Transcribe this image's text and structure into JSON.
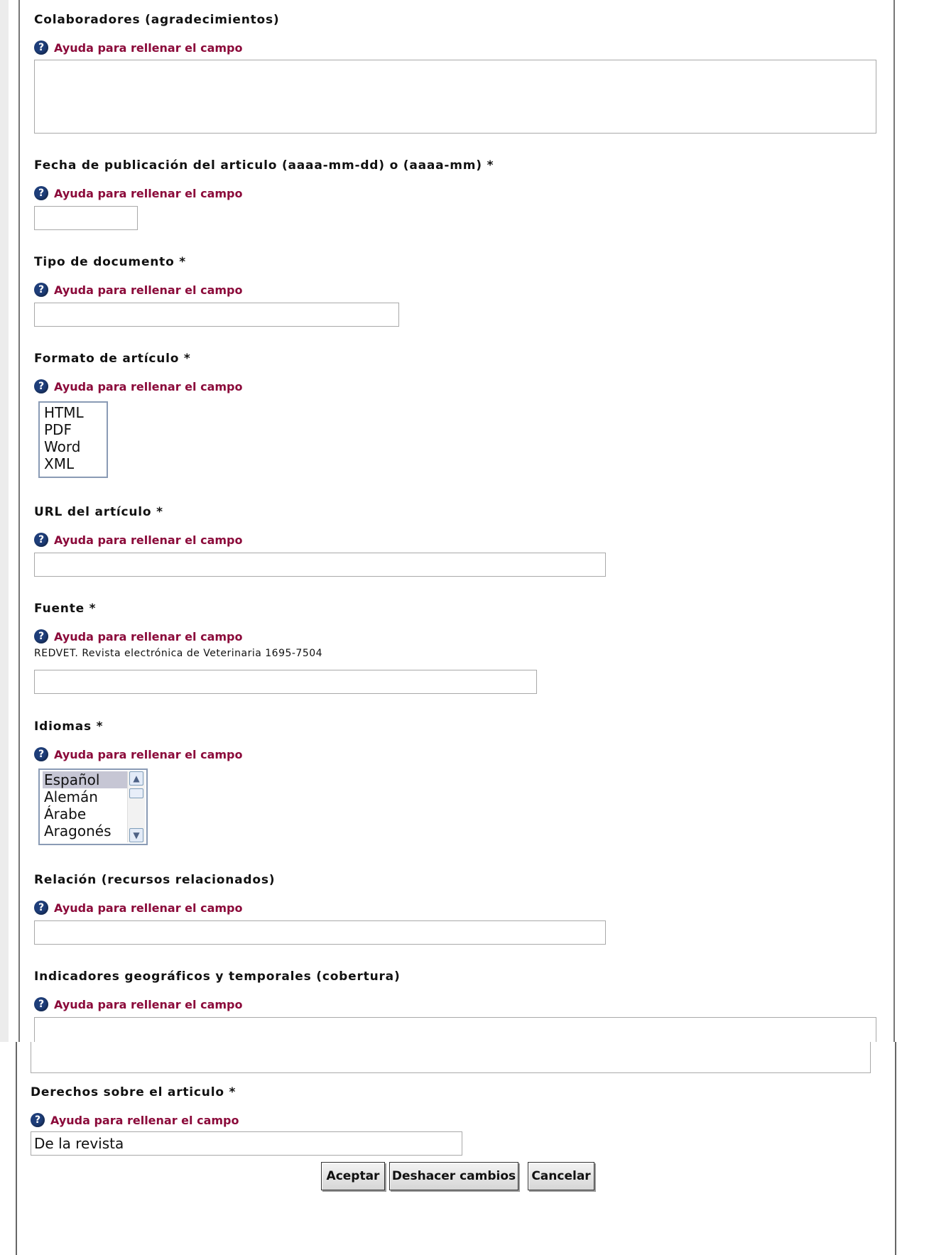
{
  "help_text": "Ayuda para rellenar el campo",
  "colors": {
    "help_link": "#8b0a3a",
    "help_icon": "#1e3e7a"
  },
  "icons": {
    "help": "question-circle-icon"
  },
  "fields": {
    "colaboradores": {
      "label": "Colaboradores (agradecimientos)",
      "value": ""
    },
    "fecha": {
      "label": "Fecha de publicación del articulo (aaaa-mm-dd) o (aaaa-mm) *",
      "value": ""
    },
    "tipo": {
      "label": "Tipo de documento *",
      "value": ""
    },
    "formato": {
      "label": "Formato de artículo *",
      "options": [
        "HTML",
        "PDF",
        "Word",
        "XML"
      ]
    },
    "url": {
      "label": "URL del artículo *",
      "value": ""
    },
    "fuente": {
      "label": "Fuente *",
      "note": "REDVET. Revista electrónica de Veterinaria 1695-7504",
      "value": ""
    },
    "idiomas": {
      "label": "Idiomas *",
      "options": [
        "Español",
        "Alemán",
        "Árabe",
        "Aragonés"
      ],
      "selected": "Español"
    },
    "relacion": {
      "label": "Relación (recursos relacionados)",
      "value": ""
    },
    "cobertura": {
      "label": "Indicadores geográficos y temporales (cobertura)",
      "value": ""
    },
    "derechos": {
      "label": "Derechos sobre el articulo *",
      "value": "De la revista"
    }
  },
  "buttons": {
    "accept": "Aceptar",
    "undo": "Deshacer cambios",
    "cancel": "Cancelar"
  }
}
